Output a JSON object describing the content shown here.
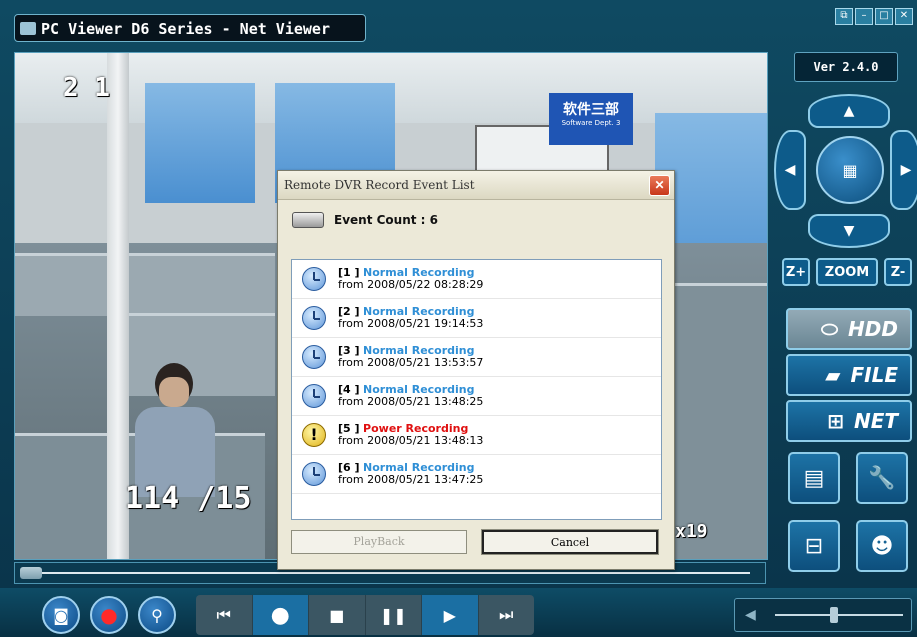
{
  "window": {
    "title": "PC Viewer D6 Series - Net Viewer",
    "version": "Ver 2.4.0"
  },
  "video": {
    "osd_top": "2 1",
    "osd_bottom": "114 /15",
    "osd_right": "x19",
    "sign_text": "软件三部",
    "sign_sub": "Software Dept. 3"
  },
  "side_panel": {
    "zoom_in_label": "Z+",
    "zoom_label": "ZOOM",
    "zoom_out_label": "Z-",
    "hdd_label": "HDD",
    "file_label": "FILE",
    "net_label": "NET"
  },
  "dialog": {
    "title": "Remote DVR Record Event List",
    "event_count_label": "Event Count : 6",
    "playback_label": "PlayBack",
    "cancel_label": "Cancel",
    "events": [
      {
        "index": "[1 ]",
        "type": "Normal Recording",
        "time": "from 2008/05/22 08:28:29",
        "kind": "normal"
      },
      {
        "index": "[2 ]",
        "type": "Normal Recording",
        "time": "from 2008/05/21 19:14:53",
        "kind": "normal"
      },
      {
        "index": "[3 ]",
        "type": "Normal Recording",
        "time": "from 2008/05/21 13:53:57",
        "kind": "normal"
      },
      {
        "index": "[4 ]",
        "type": "Normal Recording",
        "time": "from 2008/05/21 13:48:25",
        "kind": "normal"
      },
      {
        "index": "[5 ]",
        "type": "Power Recording",
        "time": "from 2008/05/21 13:48:13",
        "kind": "power"
      },
      {
        "index": "[6 ]",
        "type": "Normal Recording",
        "time": "from 2008/05/21 13:47:25",
        "kind": "normal"
      }
    ]
  },
  "playback": {
    "seek_fraction": 0.0,
    "volume_fraction": 0.45
  },
  "colors": {
    "accent": "#1b6fa3",
    "normal_event": "#2f8fd6",
    "power_event": "#e01010"
  }
}
